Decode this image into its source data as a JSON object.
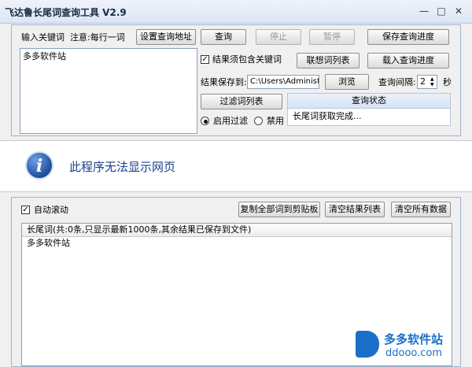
{
  "window": {
    "title": "飞达鲁长尾词查询工具 V2.9",
    "minimize": "—",
    "maximize": "□",
    "close": "✕"
  },
  "top": {
    "keyword_label": "输入关键词",
    "keyword_note": "注意:每行一词",
    "keyword_value": "多多软件站",
    "set_query_url": "设置查询地址",
    "query": "查询",
    "stop": "停止",
    "pause": "暂停",
    "save_progress": "保存查询进度",
    "must_contain_label": "结果须包含关键词",
    "must_contain_checked": "✓",
    "assoc_list": "联想词列表",
    "load_progress": "载入查询进度",
    "save_to_label": "结果保存到:",
    "save_path": "C:\\Users\\Administrat",
    "browse": "浏览",
    "interval_label": "查询间隔:",
    "interval_value": "2",
    "interval_unit": "秒",
    "filter_list": "过滤词列表",
    "enable_filter": "启用过滤",
    "disable_filter": "禁用",
    "status_title": "查询状态",
    "status_text": "长尾词获取完成..."
  },
  "webmsg": {
    "icon": "info-icon",
    "text": "此程序无法显示网页"
  },
  "bottom": {
    "autoscroll_label": "自动滚动",
    "autoscroll_checked": "✓",
    "copy_all": "复制全部词到剪贴板",
    "clear_results": "清空结果列表",
    "clear_all": "清空所有数据",
    "list_header": "长尾词(共:0条,只显示最新1000条,其余结果已保存到文件)",
    "rows": [
      "多多软件站"
    ]
  },
  "watermark": {
    "name": "多多软件站",
    "url": "ddooo.com"
  }
}
